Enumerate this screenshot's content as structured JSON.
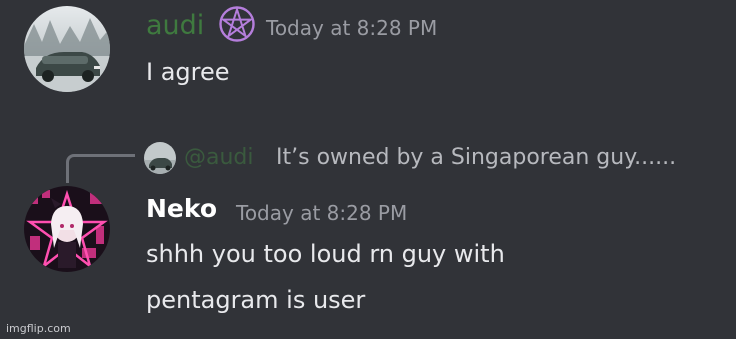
{
  "messages": [
    {
      "username": "audi",
      "username_color": "#3f7a3f",
      "badge_icon": "pentagram-icon",
      "badge_color": "#b57edc",
      "timestamp": "Today at 8:28 PM",
      "avatar_icon": "car-avatar",
      "lines": [
        "I agree"
      ]
    },
    {
      "reply": {
        "mention": "@audi",
        "text": "It’s owned by a Singaporean guy......",
        "avatar_icon": "car-avatar"
      },
      "username": "Neko",
      "username_color": "#ffffff",
      "timestamp": "Today at 8:28 PM",
      "avatar_icon": "anime-girl-avatar",
      "lines": [
        "shhh you too loud rn guy with",
        "pentagram is user"
      ]
    }
  ],
  "watermark": "imgflip.com"
}
